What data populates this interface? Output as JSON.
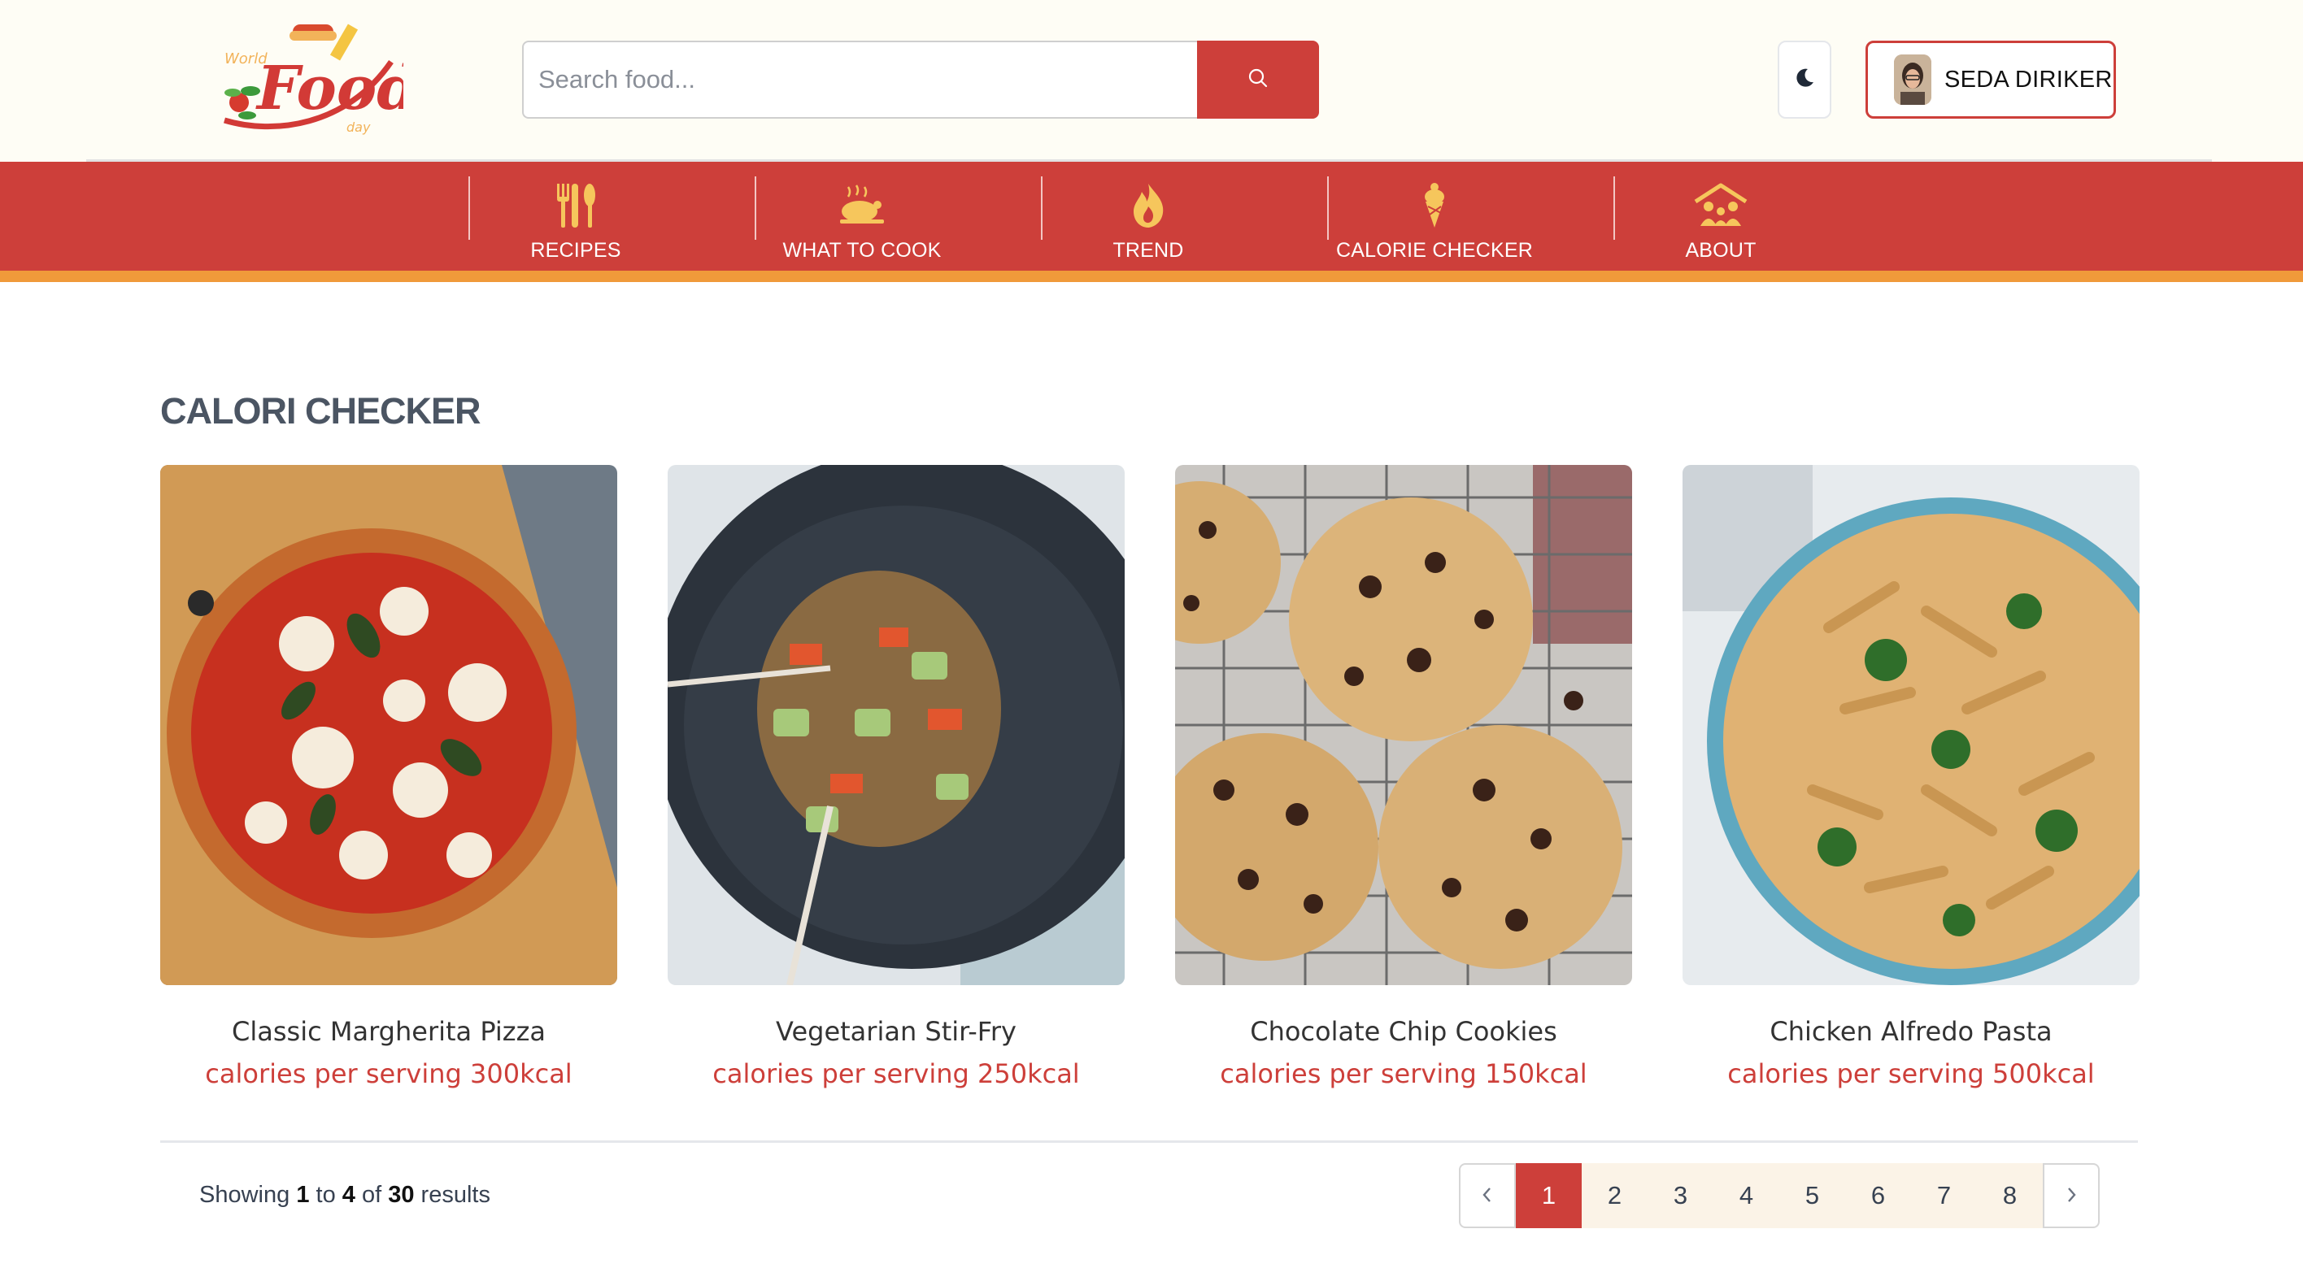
{
  "header": {
    "logo_alt": "World Food day",
    "search": {
      "placeholder": "Search food...",
      "value": ""
    },
    "user_name": "SEDA DIRIKER"
  },
  "nav": [
    {
      "label": "RECIPES",
      "icon": "utensils-icon"
    },
    {
      "label": "WHAT TO COOK",
      "icon": "roast-chicken-icon"
    },
    {
      "label": "TREND",
      "icon": "flame-icon"
    },
    {
      "label": "CALORIE CHECKER",
      "icon": "ice-cream-icon"
    },
    {
      "label": "ABOUT",
      "icon": "family-house-icon"
    }
  ],
  "colors": {
    "brand": "#cd3f3a",
    "accent": "#f09a3a",
    "icon_yellow": "#f6c65c"
  },
  "page_title": "CALORI CHECKER",
  "cards": [
    {
      "name": "Classic Margherita Pizza",
      "calories": "calories per serving 300kcal"
    },
    {
      "name": "Vegetarian Stir-Fry",
      "calories": "calories per serving 250kcal"
    },
    {
      "name": "Chocolate Chip Cookies",
      "calories": "calories per serving 150kcal"
    },
    {
      "name": "Chicken Alfredo Pasta",
      "calories": "calories per serving 500kcal"
    }
  ],
  "pagination": {
    "showing_prefix": "Showing",
    "from": "1",
    "to_word": "to",
    "to": "4",
    "of_word": "of",
    "total": "30",
    "results_word": "results",
    "pages": [
      "1",
      "2",
      "3",
      "4",
      "5",
      "6",
      "7",
      "8"
    ],
    "current": "1"
  }
}
